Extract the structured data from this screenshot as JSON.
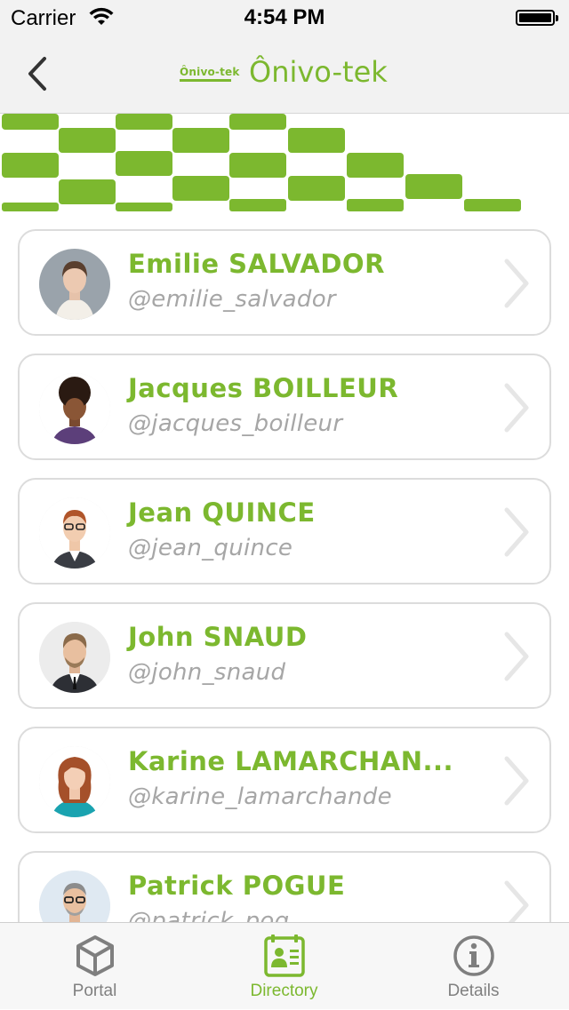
{
  "status_bar": {
    "carrier": "Carrier",
    "time": "4:54 PM"
  },
  "nav": {
    "logo_text": "Ônivo-tek",
    "title": "Ônivo-tek"
  },
  "theme": {
    "accent": "#7cb82f",
    "muted": "#a6a6a6",
    "border": "#dcdcdc"
  },
  "contacts": [
    {
      "name": "Emilie SALVADOR",
      "handle": "@emilie_salvador"
    },
    {
      "name": "Jacques BOILLEUR",
      "handle": "@jacques_boilleur"
    },
    {
      "name": "Jean QUINCE",
      "handle": "@jean_quince"
    },
    {
      "name": "John SNAUD",
      "handle": "@john_snaud"
    },
    {
      "name": "Karine LAMARCHAN...",
      "handle": "@karine_lamarchande"
    },
    {
      "name": "Patrick POGUE",
      "handle": "@patrick_pog..."
    }
  ],
  "tabs": [
    {
      "label": "Portal",
      "icon": "cube-icon",
      "active": false
    },
    {
      "label": "Directory",
      "icon": "contact-card-icon",
      "active": true
    },
    {
      "label": "Details",
      "icon": "info-icon",
      "active": false
    }
  ]
}
